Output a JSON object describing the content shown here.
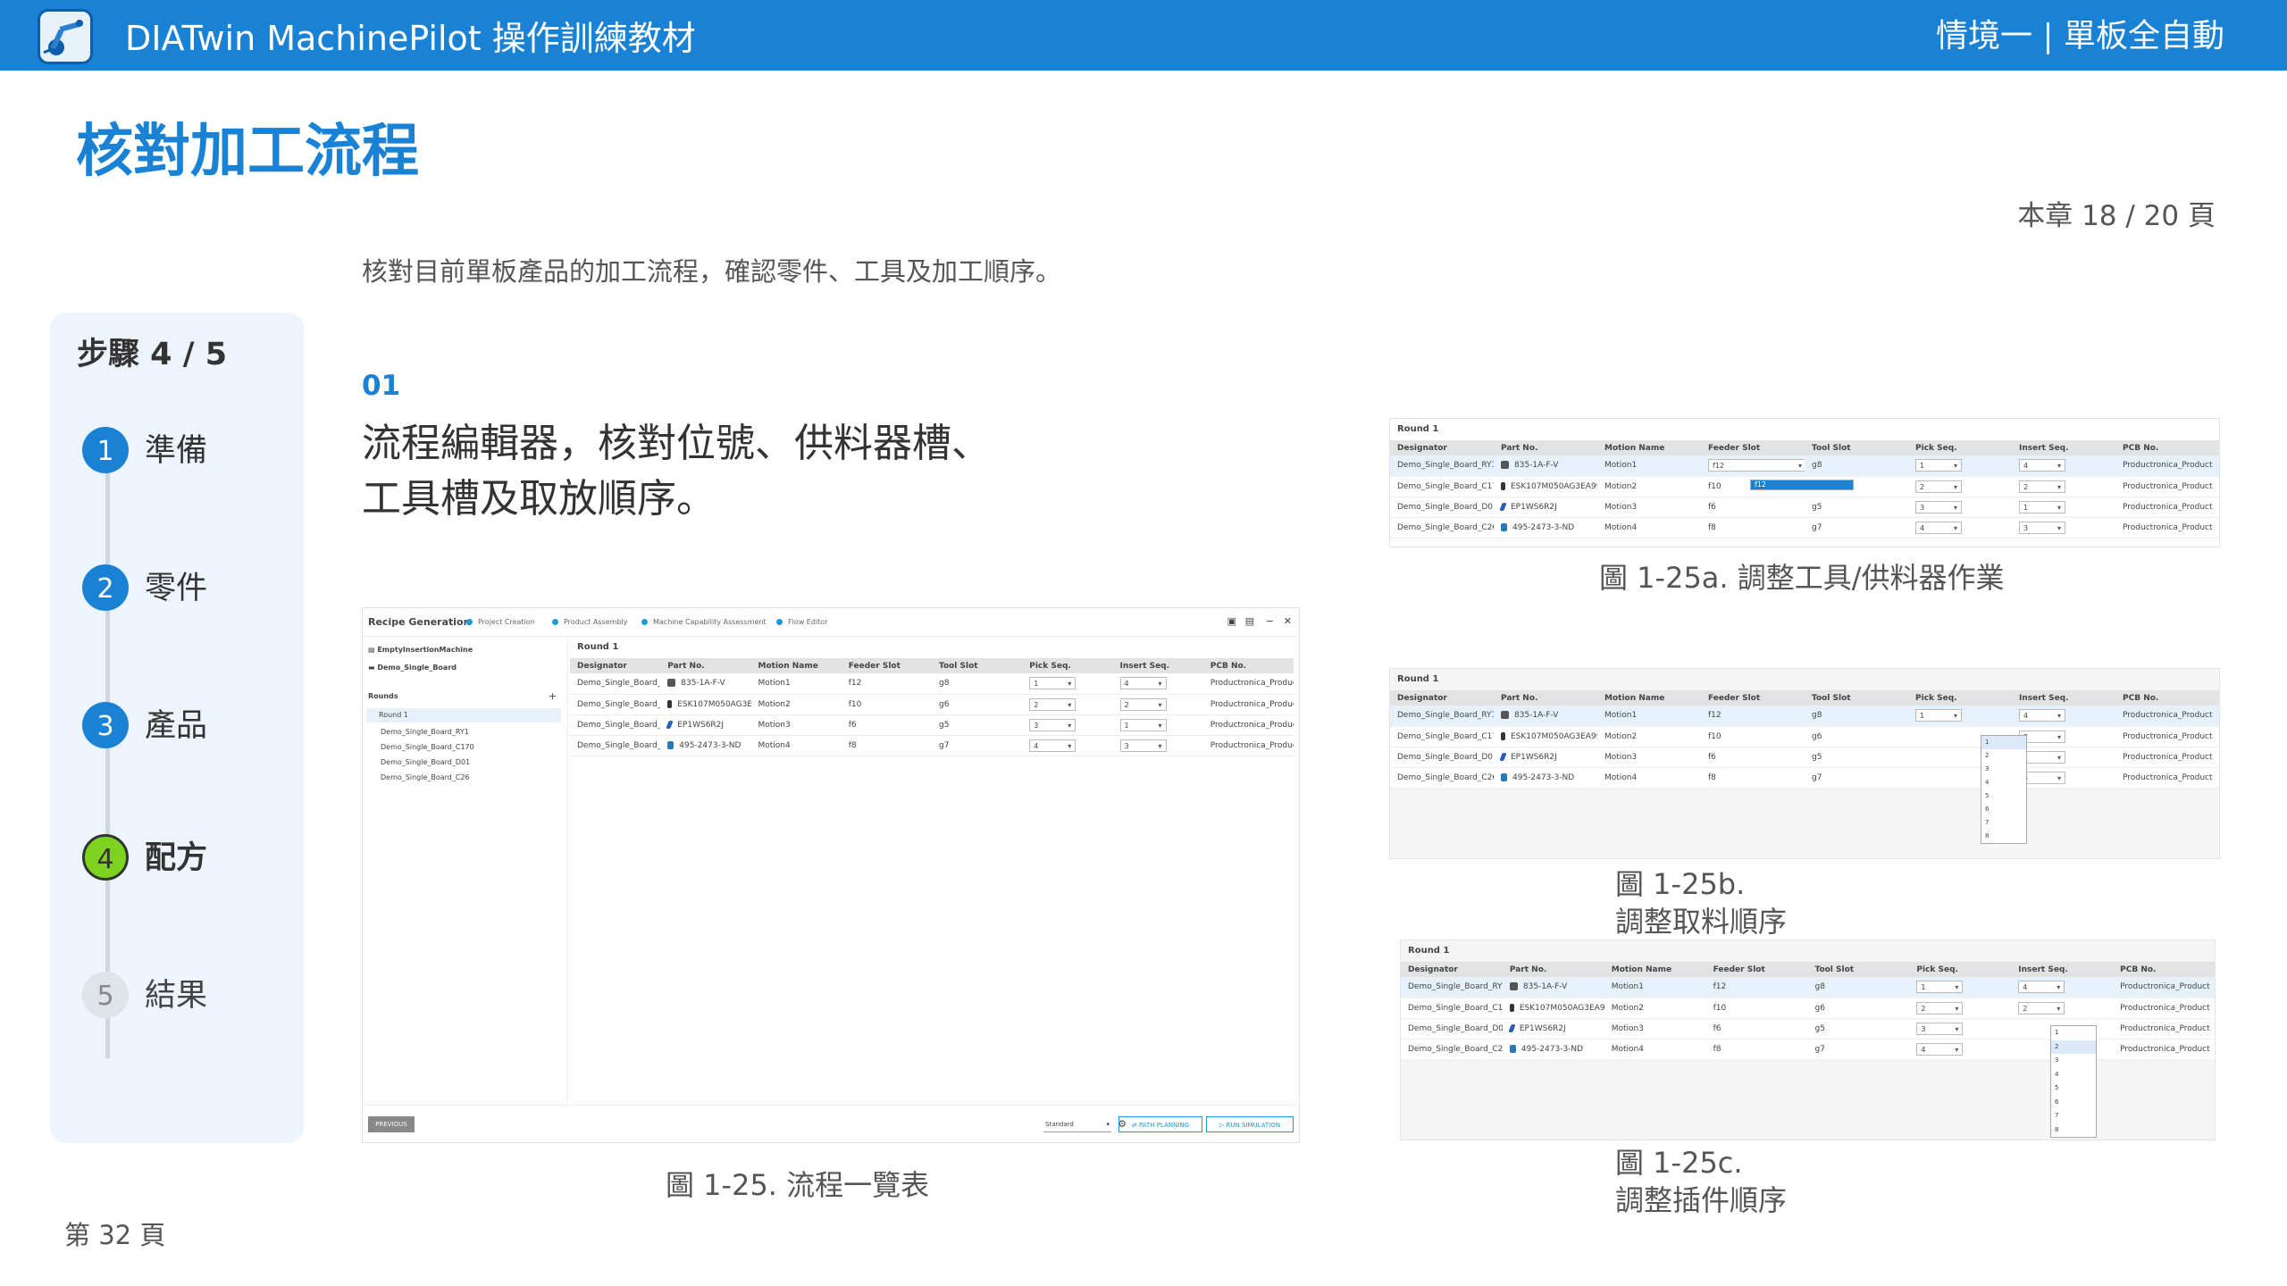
{
  "header": {
    "app_title": "DIATwin MachinePilot 操作訓練教材",
    "scenario": "情境一 | 單板全自動",
    "color": "#1a82d4"
  },
  "page": {
    "title": "核對加工流程",
    "chapter_page": "本章 18 / 20 頁",
    "description": "核對目前單板產品的加工流程，確認零件、工具及加工順序。",
    "page_number": "第 32 頁"
  },
  "steps": {
    "title": "步驟 4 / 5",
    "items": [
      {
        "num": "1",
        "label": "準備",
        "state": "done"
      },
      {
        "num": "2",
        "label": "零件",
        "state": "done"
      },
      {
        "num": "3",
        "label": "產品",
        "state": "done"
      },
      {
        "num": "4",
        "label": "配方",
        "state": "current"
      },
      {
        "num": "5",
        "label": "結果",
        "state": "future"
      }
    ]
  },
  "section": {
    "num": "01",
    "heading": "流程編輯器，核對位號、供料器槽、工具槽及取放順序。"
  },
  "captions": {
    "main": "圖 1-25. 流程一覽表",
    "a": "圖 1-25a. 調整工具/供料器作業",
    "b_line1": "圖 1-25b.",
    "b_line2": "調整取料順序",
    "c_line1": "圖 1-25c.",
    "c_line2": "調整插件順序"
  },
  "recipe": {
    "window_title": "Recipe Generation",
    "wizard_steps": [
      "Project Creation",
      "Product Assembly",
      "Machine Capability Assessment",
      "Flow Editor"
    ],
    "machine": "EmptyInsertionMachine",
    "board": "Demo_Single_Board",
    "rounds_label": "Rounds",
    "add_symbol": "+",
    "tree": [
      "Round 1",
      "Demo_Single_Board_RY1",
      "Demo_Single_Board_C170",
      "Demo_Single_Board_D01",
      "Demo_Single_Board_C26"
    ],
    "round_label": "Round 1",
    "columns": [
      "Designator",
      "Part No.",
      "Motion Name",
      "Feeder Slot",
      "Tool Slot",
      "Pick Seq.",
      "Insert Seq.",
      "PCB No."
    ],
    "rows": [
      {
        "designator": "Demo_Single_Board_RY1",
        "part": "835-1A-F-V",
        "motion": "Motion1",
        "feeder": "f12",
        "tool": "g8",
        "pick": "1",
        "insert": "4",
        "pcb": "Productronica_Product"
      },
      {
        "designator": "Demo_Single_Board_C170",
        "part": "ESK107M050AG3EA9999",
        "motion": "Motion2",
        "feeder": "f10",
        "tool": "g6",
        "pick": "2",
        "insert": "2",
        "pcb": "Productronica_Product"
      },
      {
        "designator": "Demo_Single_Board_D01",
        "part": "EP1WS6R2J",
        "motion": "Motion3",
        "feeder": "f6",
        "tool": "g5",
        "pick": "3",
        "insert": "1",
        "pcb": "Productronica_Product"
      },
      {
        "designator": "Demo_Single_Board_C26",
        "part": "495-2473-3-ND",
        "motion": "Motion4",
        "feeder": "f8",
        "tool": "g7",
        "pick": "4",
        "insert": "3",
        "pcb": "Productronica_Product"
      }
    ],
    "previous_label": "PREVIOUS",
    "mode_value": "Standard",
    "path_planning_label": "PATH PLANNING",
    "run_simulation_label": "RUN SIMULATION",
    "feeder_dropdown_value": "f12",
    "feeder_dropdown_option": "f12",
    "pick_options": [
      "1",
      "2",
      "3",
      "4",
      "5",
      "6",
      "7",
      "8"
    ],
    "insert_options": [
      "1",
      "2",
      "3",
      "4",
      "5",
      "6",
      "7",
      "8"
    ],
    "c_insert_row2": "2"
  }
}
